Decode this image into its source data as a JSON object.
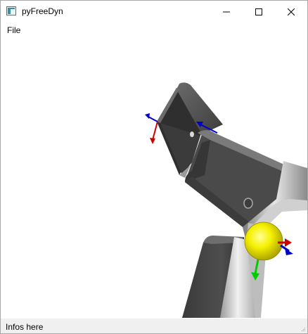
{
  "window": {
    "title": "pyFreeDyn",
    "app_icon": "pyfreedyn-app-icon",
    "controls": {
      "minimize_icon": "minimize-icon",
      "maximize_icon": "maximize-icon",
      "close_icon": "close-icon"
    }
  },
  "menubar": {
    "items": [
      {
        "label": "File"
      }
    ]
  },
  "viewport": {
    "description_icon": "3d-scene",
    "colors": {
      "background": "#ffffff",
      "link_body": "#4a4a4a",
      "link_highlight": "#c8c8c8",
      "sphere": "#f4f000",
      "axis_x": "#cc0000",
      "axis_y": "#00cc00",
      "axis_z": "#0000cc"
    }
  },
  "statusbar": {
    "text": "Infos here"
  }
}
